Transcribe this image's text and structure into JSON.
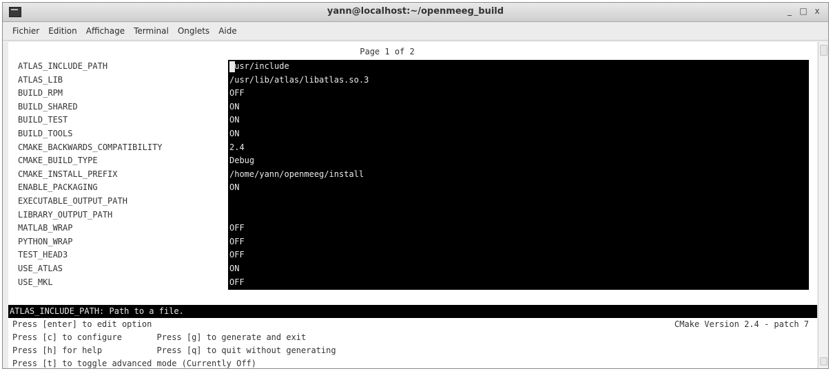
{
  "window": {
    "title": "yann@localhost:~/openmeeg_build",
    "buttons": [
      "_",
      "□",
      "x"
    ]
  },
  "menu": [
    "Fichier",
    "Edition",
    "Affichage",
    "Terminal",
    "Onglets",
    "Aide"
  ],
  "terminal": {
    "page_indicator": "Page 1 of 2",
    "options": [
      {
        "name": "ATLAS_INCLUDE_PATH",
        "value": "/usr/include"
      },
      {
        "name": "ATLAS_LIB",
        "value": "/usr/lib/atlas/libatlas.so.3"
      },
      {
        "name": "BUILD_RPM",
        "value": "OFF"
      },
      {
        "name": "BUILD_SHARED",
        "value": "ON"
      },
      {
        "name": "BUILD_TEST",
        "value": "ON"
      },
      {
        "name": "BUILD_TOOLS",
        "value": "ON"
      },
      {
        "name": "CMAKE_BACKWARDS_COMPATIBILITY",
        "value": "2.4"
      },
      {
        "name": "CMAKE_BUILD_TYPE",
        "value": "Debug"
      },
      {
        "name": "CMAKE_INSTALL_PREFIX",
        "value": "/home/yann/openmeeg/install"
      },
      {
        "name": "ENABLE_PACKAGING",
        "value": "ON"
      },
      {
        "name": "EXECUTABLE_OUTPUT_PATH",
        "value": ""
      },
      {
        "name": "LIBRARY_OUTPUT_PATH",
        "value": ""
      },
      {
        "name": "MATLAB_WRAP",
        "value": "OFF"
      },
      {
        "name": "PYTHON_WRAP",
        "value": "OFF"
      },
      {
        "name": "TEST_HEAD3",
        "value": "OFF"
      },
      {
        "name": "USE_ATLAS",
        "value": "ON"
      },
      {
        "name": "USE_MKL",
        "value": "OFF"
      }
    ],
    "status_line": "ATLAS_INCLUDE_PATH: Path to a file.",
    "help_lines": [
      "Press [enter] to edit option",
      "Press [c] to configure       Press [g] to generate and exit",
      "Press [h] for help           Press [q] to quit without generating",
      "Press [t] to toggle advanced mode (Currently Off)"
    ],
    "version": "CMake Version 2.4 - patch 7"
  }
}
